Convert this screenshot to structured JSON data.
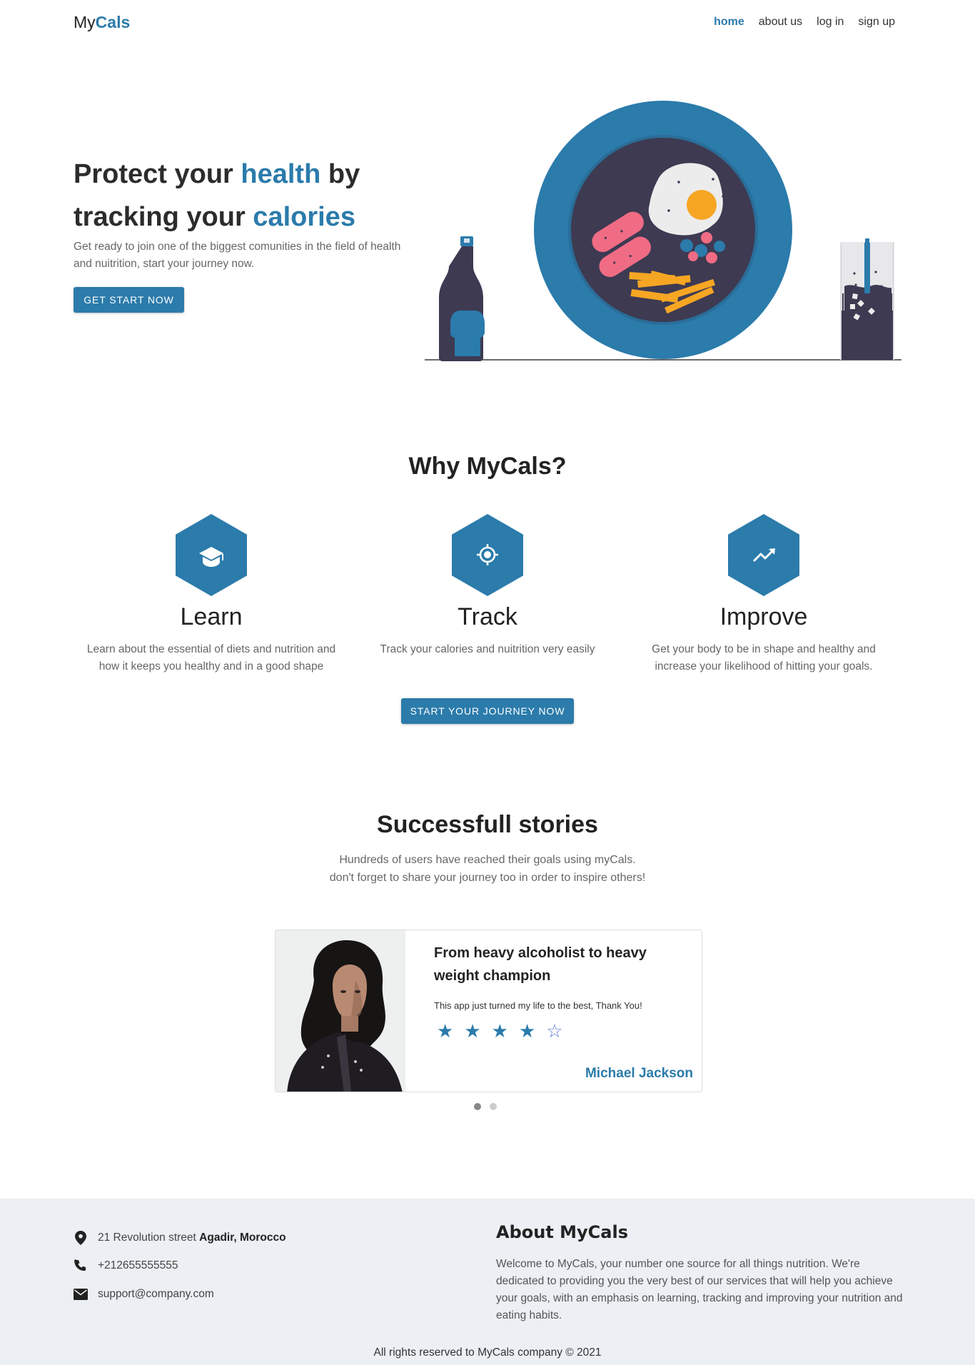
{
  "header": {
    "logo_prefix": "My",
    "logo_accent": "Cals",
    "nav": [
      "home",
      "about us",
      "log in",
      "sign up"
    ]
  },
  "hero": {
    "title_1": "Protect your ",
    "title_hl1": "health",
    "title_2": " by tracking your ",
    "title_hl2": "calories",
    "subtitle": "Get ready to join one of the biggest comunities in the field of health and nuitrition, start your journey now.",
    "cta": "GET START NOW"
  },
  "why": {
    "title": "Why MyCals?",
    "features": [
      {
        "icon": "graduation-cap-icon",
        "title": "Learn",
        "desc": "Learn about the essential of diets and nutrition and how it keeps you healthy and in a good shape"
      },
      {
        "icon": "crosshair-icon",
        "title": "Track",
        "desc": "Track your calories and nuitrition very easily"
      },
      {
        "icon": "trending-up-icon",
        "title": "Improve",
        "desc": "Get your body to be in shape and healthy and increase your likelihood of hitting your goals."
      }
    ],
    "cta": "START YOUR JOURNEY NOW"
  },
  "stories": {
    "title": "Successfull stories",
    "sub_1": "Hundreds of users have reached their goals using myCals.",
    "sub_2": "don't forget to share your journey too in order to inspire others!",
    "card": {
      "title": "From heavy alcoholist to heavy weight champion",
      "text": "This app just turned my life to the best, Thank You!",
      "rating": 4,
      "max_rating": 5,
      "author": "Michael Jackson"
    },
    "slides": 2,
    "active_slide": 0
  },
  "footer": {
    "address_plain": "21 Revolution street ",
    "address_bold": "Agadir, Morocco",
    "phone": "+212655555555",
    "email": "support@company.com",
    "about_title": "About MyCals",
    "about_text": "Welcome to MyCals, your number one source for all things nutrition. We're dedicated to providing you the very best of our services that will help you achieve your goals, with an emphasis on learning, tracking and improving your nutrition and eating habits.",
    "copyright": "All rights reserved to MyCals company © 2021"
  },
  "colors": {
    "accent": "#2b7bab",
    "plate_inner": "#3d3a52",
    "footer_bg": "#eceff3"
  }
}
